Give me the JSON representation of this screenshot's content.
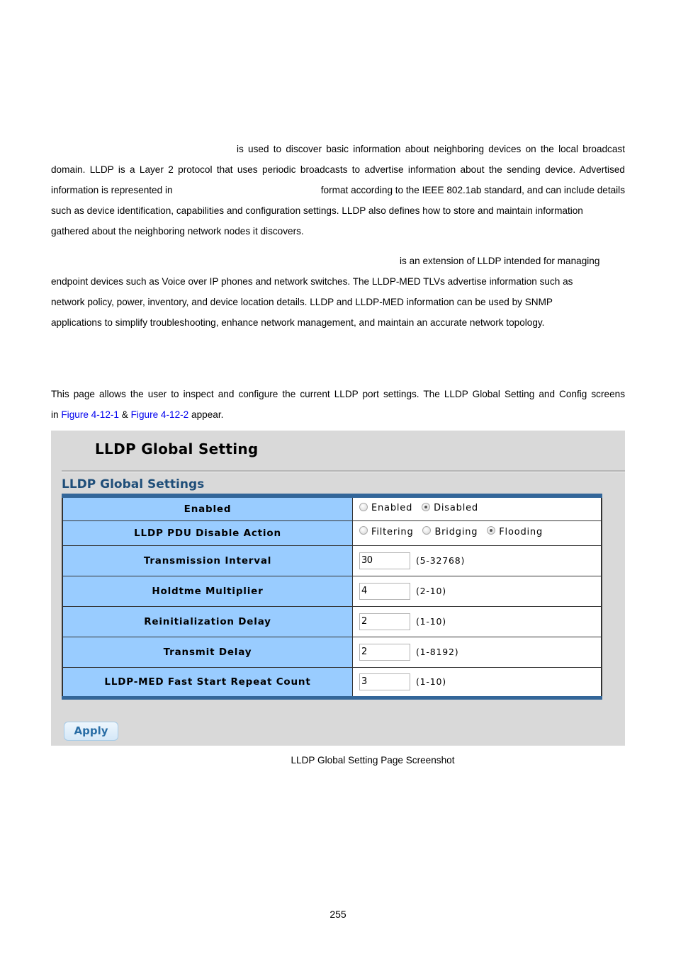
{
  "intro_paragraph": {
    "lines": [
      "is used to discover basic information about neighboring devices on the local broadcast",
      "domain. LLDP is a Layer 2 protocol that uses periodic broadcasts to advertise information about the sending device. Advertised",
      [
        "information is represented in",
        "format according to the IEEE 802.1ab standard, and can include details"
      ],
      "such as device identification, capabilities and configuration settings. LLDP also defines how to store and maintain information",
      "gathered about the neighboring network nodes it discovers."
    ]
  },
  "med_paragraph": {
    "lines": [
      "is an extension of LLDP intended for managing",
      "endpoint devices such as Voice over IP phones and network switches. The LLDP-MED TLVs advertise information such as",
      "network policy, power, inventory, and device location details. LLDP and LLDP-MED information can be used by SNMP",
      "applications to simplify troubleshooting, enhance network management, and maintain an accurate network topology."
    ]
  },
  "page_paragraph": {
    "line1": "This page allows the user to inspect and configure the current LLDP port settings. The LLDP Global Setting and Config screens",
    "prefix": "in",
    "link1": "Figure 4-12-1",
    "amp": "&",
    "link2": "Figure 4-12-2",
    "suffix": "appear."
  },
  "screenshot": {
    "title": "LLDP Global Setting",
    "section_title": "LLDP Global Settings",
    "rows": [
      {
        "label": "Enabled",
        "type": "radio",
        "options": [
          {
            "label": "Enabled",
            "checked": false
          },
          {
            "label": "Disabled",
            "checked": true
          }
        ]
      },
      {
        "label": "LLDP PDU Disable Action",
        "type": "radio",
        "options": [
          {
            "label": "Filtering",
            "checked": false
          },
          {
            "label": "Bridging",
            "checked": false
          },
          {
            "label": "Flooding",
            "checked": true
          }
        ]
      },
      {
        "label": "Transmission Interval",
        "type": "input",
        "value": "30",
        "range": "(5-32768)"
      },
      {
        "label": "Holdtme Multiplier",
        "type": "input",
        "value": "4",
        "range": "(2-10)"
      },
      {
        "label": "Reinitialization Delay",
        "type": "input",
        "value": "2",
        "range": "(1-10)"
      },
      {
        "label": "Transmit Delay",
        "type": "input",
        "value": "2",
        "range": "(1-8192)"
      },
      {
        "label": "LLDP-MED Fast Start Repeat Count",
        "type": "input",
        "value": "3",
        "range": "(1-10)"
      }
    ],
    "apply_label": "Apply",
    "colors": {
      "label_bg": "#99ccff",
      "table_border": "#336699",
      "panel_bg": "#d9d9d9",
      "section_title": "#1f4e79",
      "link": "#0000ee"
    }
  },
  "caption": "LLDP Global Setting Page Screenshot",
  "page_number": "255"
}
